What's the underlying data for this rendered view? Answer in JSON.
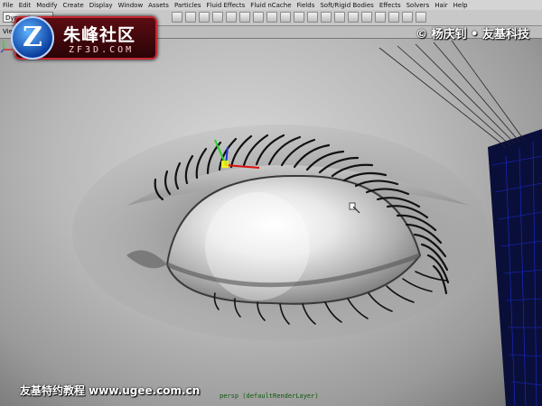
{
  "app": {
    "menus": [
      "File",
      "Edit",
      "Modify",
      "Create",
      "Display",
      "Window",
      "Assets",
      "Particles",
      "Fluid Effects",
      "Fluid nCache",
      "Fields",
      "Soft/Rigid Bodies",
      "Effects",
      "Solvers",
      "Hair",
      "Help"
    ],
    "mode_select": "Dynami",
    "panel_label": "Vie"
  },
  "overlay": {
    "logo_title": "朱峰社区",
    "logo_sub": "ZF3D.COM",
    "logo_badge": "Z",
    "watermark": "© 杨庆钊 • 友基科技",
    "footer_credit": "友基特约教程 www.ugee.com.cn"
  },
  "viewport": {
    "camera_label": "persp (defaultRenderLayer)"
  },
  "icons": {
    "shelf": [
      "select-tool-icon",
      "lasso-tool-icon",
      "paint-select-icon",
      "move-tool-icon",
      "rotate-tool-icon",
      "scale-tool-icon",
      "manipulator-icon",
      "help-icon",
      "lock-icon",
      "magnet-icon",
      "snap-grid-icon",
      "snap-curve-icon",
      "snap-point-icon",
      "snap-plane-icon",
      "history-icon",
      "render-icon",
      "ipr-render-icon",
      "render-settings-icon",
      "hypershade-icon"
    ]
  },
  "colors": {
    "logo_red": "#c52631",
    "hair_blue": "#1a2bd6"
  }
}
